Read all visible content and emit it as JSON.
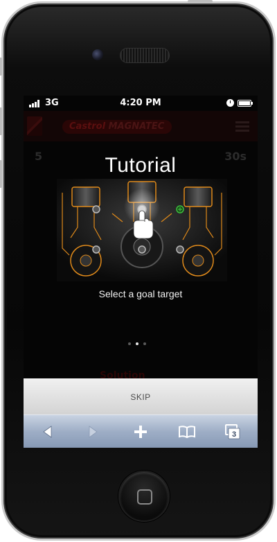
{
  "status": {
    "carrier": "3G",
    "time": "4:20 PM"
  },
  "app": {
    "brand_main": "Castrol",
    "brand_sub": "MAGNATEC",
    "score_left": "5",
    "score_right": "30s",
    "bottom_faded": "Solution"
  },
  "tutorial": {
    "title": "Tutorial",
    "caption": "Select a goal target",
    "page_count": 3,
    "active_page": 2
  },
  "skip_label": "SKIP",
  "safari_toolbar": {
    "tabs_count": "3",
    "icons": [
      "back-icon",
      "forward-icon",
      "add-icon",
      "bookmarks-icon",
      "tabs-icon"
    ]
  },
  "colors": {
    "target_active": "#3cbf3c",
    "engine_glow": "#e08a1a",
    "toolbar_blue": "#9eaec6"
  }
}
